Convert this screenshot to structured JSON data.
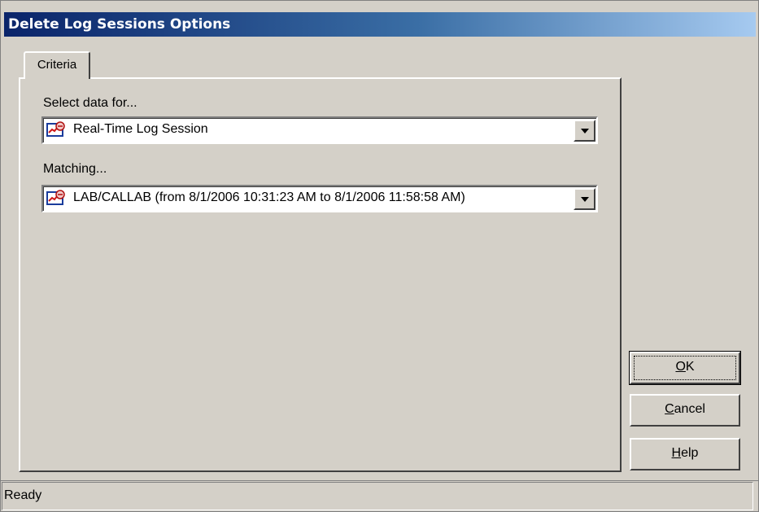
{
  "window": {
    "title": "Delete Log Sessions Options"
  },
  "tabs": [
    {
      "label": "Criteria"
    }
  ],
  "criteria": {
    "select_label": "Select data for...",
    "select_value": "Real-Time Log Session",
    "select_icon": "log-session-icon",
    "matching_label": "Matching...",
    "matching_value": "LAB/CALLAB (from 8/1/2006 10:31:23 AM to 8/1/2006 11:58:58 AM)",
    "matching_icon": "log-session-icon"
  },
  "buttons": {
    "ok": {
      "mnemonic": "O",
      "rest": "K"
    },
    "cancel": {
      "mnemonic": "C",
      "rest": "ancel"
    },
    "help": {
      "mnemonic": "H",
      "rest": "elp"
    }
  },
  "status": {
    "text": "Ready"
  }
}
